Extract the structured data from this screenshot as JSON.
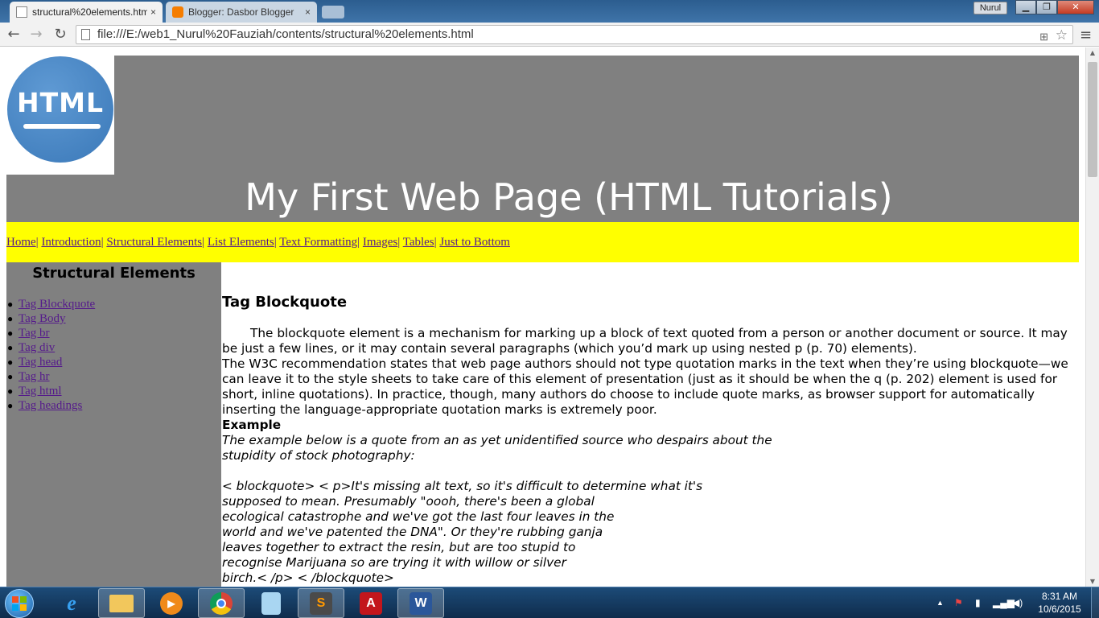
{
  "browser": {
    "tabs": [
      {
        "title": "structural%20elements.htm",
        "close": "×"
      },
      {
        "title": "Blogger: Dasbor Blogger",
        "close": "×"
      }
    ],
    "profile_name": "Nurul",
    "window_controls": {
      "minimize": "▁",
      "maximize": "❐",
      "close": "✕"
    },
    "nav": {
      "back": "←",
      "forward": "→",
      "reload": "↻"
    },
    "url": "file:///E:/web1_Nurul%20Fauziah/contents/structural%20elements.html",
    "icons": {
      "translate": "⊞",
      "star": "☆",
      "menu": "≡"
    }
  },
  "page": {
    "logo_text": "HTML",
    "site_title": "My First Web Page (HTML Tutorials)",
    "nav_links": [
      "Home",
      "Introduction",
      "Structural Elements",
      "List Elements",
      "Text Formatting",
      "Images",
      "Tables",
      "Just to Bottom"
    ],
    "nav_separator": "|",
    "sidebar": {
      "title": "Structural Elements",
      "items": [
        "Tag Blockquote",
        "Tag Body",
        "Tag br",
        "Tag div",
        "Tag head",
        "Tag hr",
        "Tag html",
        "Tag headings"
      ]
    },
    "content": {
      "heading": "Tag Blockquote",
      "para1": "The blockquote element is a mechanism for marking up a block of text quoted from a person or another document or source. It may be just a few lines, or it may contain several paragraphs (which you’d mark up using nested p (p. 70) elements).",
      "para2": "The W3C recommendation states that web page authors should not type quotation marks in the text when they’re using blockquote—we can leave it to the style sheets to take care of this element of presentation (just as it should be when the q (p. 202) element is used for short, inline quotations). In practice, though, many authors do choose to include quote marks, as browser support for automatically inserting the language-appropriate quotation marks is extremely poor.",
      "example_label": "Example",
      "example_intro": [
        "The example below is a quote from an as yet unidentified source who despairs about the",
        "stupidity of stock photography:"
      ],
      "code_lines": [
        "< blockquote> < p>It's missing alt text, so it's difficult to determine what it's",
        "supposed to mean. Presumably \"oooh, there's been a global",
        "ecological catastrophe and we've got the last four leaves in the",
        "world and we've patented the DNA\". Or they're rubbing ganja",
        "leaves together to extract the resin, but are too stupid to",
        "recognise Marijuana so are trying it with willow or silver",
        "birch.< /p> < /blockquote>"
      ]
    }
  },
  "taskbar": {
    "clock_time": "8:31 AM",
    "clock_date": "10/6/2015",
    "apps": [
      "internet-explorer",
      "file-explorer",
      "media-player",
      "google-chrome",
      "notepad",
      "sublime-text",
      "adobe-acrobat",
      "microsoft-word"
    ],
    "glyphs": {
      "ie": "e",
      "media": "▶",
      "sublime": "S",
      "acrobat": "A",
      "word": "W"
    }
  },
  "colors": {
    "header_bg": "#808080",
    "navbar_bg": "#ffff00",
    "sidebar_bg": "#808080",
    "link": "#551a8b"
  }
}
